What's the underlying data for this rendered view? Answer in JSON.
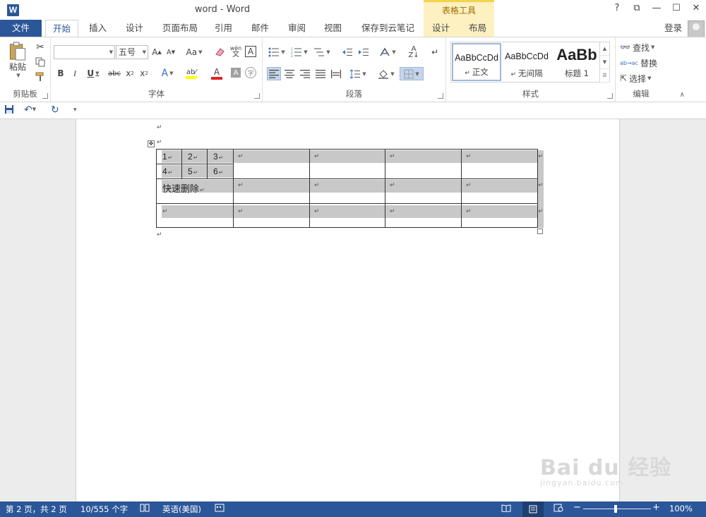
{
  "window": {
    "title": "word - Word",
    "app_icon_letter": "W",
    "help": "?",
    "controls": [
      "⧉",
      "—",
      "☐",
      "✕"
    ]
  },
  "tabs": {
    "file": "文件",
    "items": [
      "开始",
      "插入",
      "设计",
      "页面布局",
      "引用",
      "邮件",
      "审阅",
      "视图",
      "保存到云笔记",
      "设计",
      "布局"
    ],
    "contextual_header": "表格工具",
    "signin": "登录"
  },
  "ribbon": {
    "clipboard": {
      "label": "剪贴板",
      "paste": "粘贴"
    },
    "font": {
      "label": "字体",
      "font_name": "",
      "font_size": "五号"
    },
    "paragraph": {
      "label": "段落"
    },
    "styles": {
      "label": "样式",
      "items": [
        {
          "sample": "AaBbCcDd",
          "name": "正文"
        },
        {
          "sample": "AaBbCcDd",
          "name": "无间隔"
        },
        {
          "sample": "AaBb",
          "name": "标题 1"
        }
      ]
    },
    "editing": {
      "label": "编辑",
      "find": "查找",
      "replace": "替换",
      "select": "选择"
    }
  },
  "document": {
    "table": {
      "row1_cells": [
        "1",
        "2",
        "3"
      ],
      "row2_cells": [
        "4",
        "5",
        "6"
      ],
      "row3_text": "快速删除"
    },
    "para_mark": "↵"
  },
  "statusbar": {
    "page": "第 2 页，共 2 页",
    "words": "10/555 个字",
    "language": "英语(美国)",
    "zoom": "100%"
  },
  "watermark": {
    "main": "Bai du 经验",
    "sub": "jingyan.baidu.com"
  },
  "colors": {
    "accent": "#2b579a",
    "contextual": "#fdf0c1",
    "cell_shading": "#c8c8c8"
  }
}
